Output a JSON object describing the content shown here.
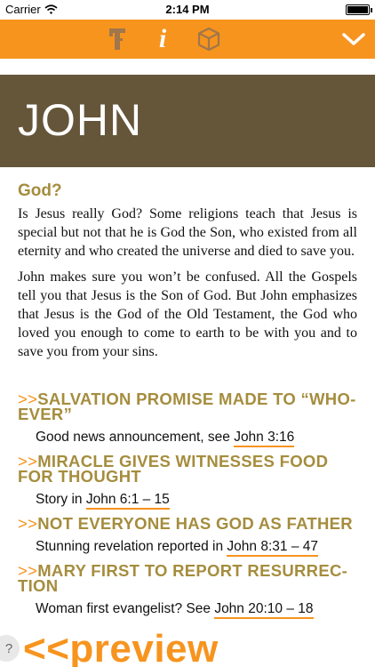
{
  "status_bar": {
    "carrier": "Carrier",
    "time": "2:14 PM"
  },
  "toolbar": {
    "accent_color": "#f7941e",
    "icons": [
      "tools-icon",
      "info-icon",
      "box-icon",
      "chevron-down-icon"
    ],
    "info_glyph": "i"
  },
  "banner": {
    "title": "JOHN",
    "color": "#655539"
  },
  "intro": {
    "heading": "God?",
    "paragraphs": [
      "Is Jesus really God? Some religions teach that Jesus is special but not that he is God the Son, who existed from all eternity and who created the universe and died to save you.",
      "John makes sure you won’t be confused. All the Gospels tell you that Jesus is the Son of God. But John emphasizes that Jesus is the God of the Old Testament, the God who loved you enough to come to earth to be with you and to save you from your sins."
    ]
  },
  "topics": [
    {
      "arrows": ">>",
      "title": "SALVATION PROMISE MADE TO “WHO-EVER”",
      "text": "Good news announcement, see ",
      "ref": "John 3:16"
    },
    {
      "arrows": ">>",
      "title": "MIRACLE GIVES WITNESSES FOOD FOR THOUGHT",
      "text": "Story in ",
      "ref": "John 6:1 – 15"
    },
    {
      "arrows": ">>",
      "title": "NOT EVERYONE HAS GOD AS FATHER",
      "text": "Stunning revelation reported in ",
      "ref": "John 8:31 – 47"
    },
    {
      "arrows": ">>",
      "title": "MARY FIRST TO REPORT RESURREC-TION",
      "text": "Woman first evangelist? See ",
      "ref": "John 20:10 – 18"
    }
  ],
  "footer": {
    "help": "?",
    "preview": "<<preview"
  }
}
